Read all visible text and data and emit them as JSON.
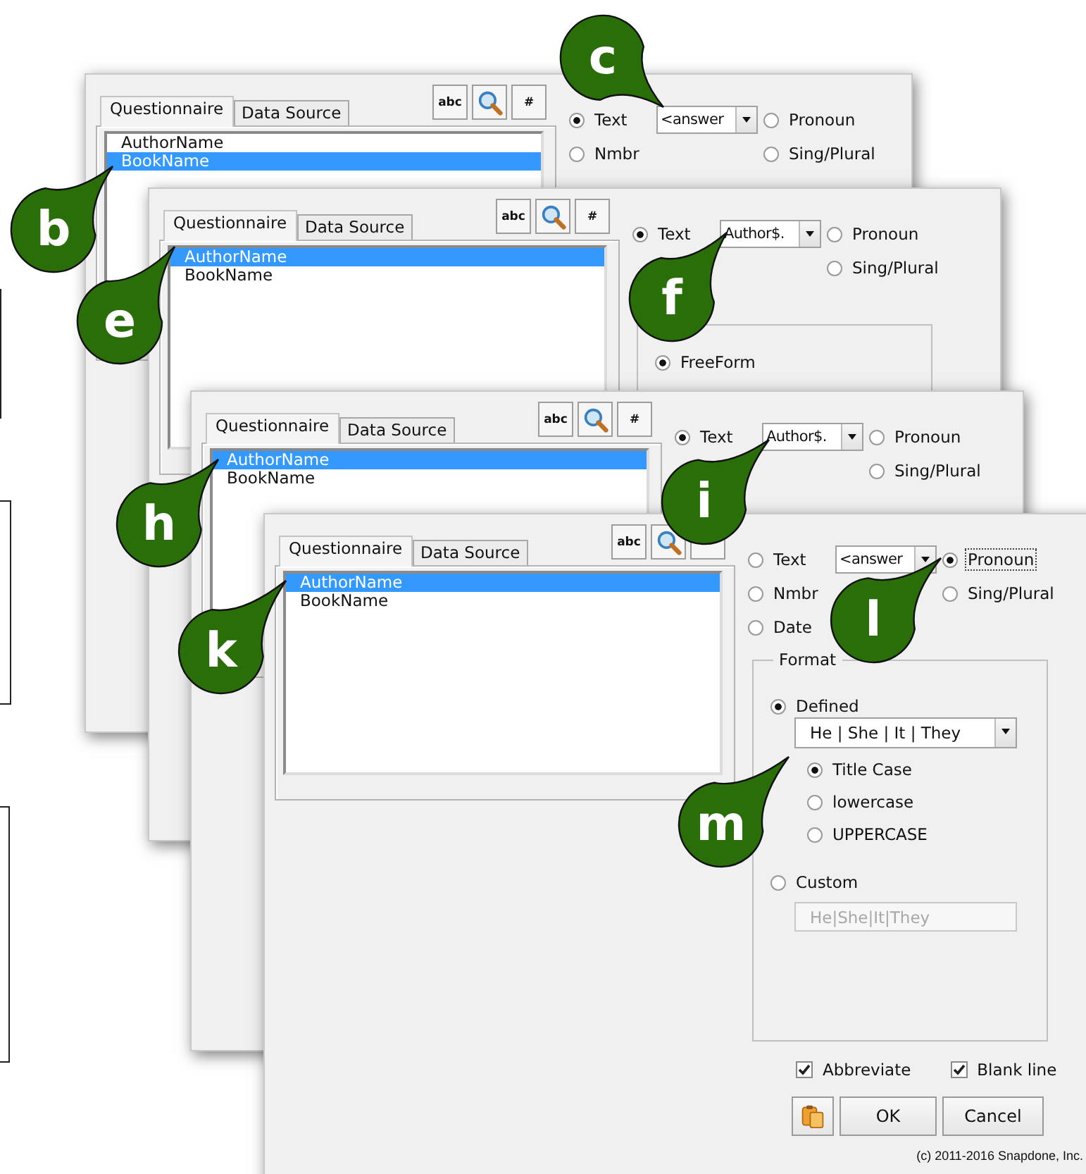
{
  "windows": [
    {
      "tabs": [
        {
          "label": "Questionnaire",
          "selected": true
        },
        {
          "label": "Data Source",
          "selected": false
        }
      ],
      "tools": [
        {
          "kind": "text",
          "label": "abc"
        },
        {
          "kind": "search"
        },
        {
          "kind": "text",
          "label": "#"
        }
      ],
      "list": [
        {
          "label": "AuthorName",
          "selected": false
        },
        {
          "label": "BookName",
          "selected": true
        }
      ],
      "type_rows": [
        {
          "left": {
            "label": "Text",
            "selected": true,
            "focused": false
          },
          "combo": "<answer",
          "right": {
            "label": "Pronoun",
            "selected": false,
            "focused": false
          }
        },
        {
          "left": {
            "label": "Nmbr",
            "selected": false,
            "focused": false
          },
          "right": {
            "label": "Sing/Plural",
            "selected": false,
            "focused": false
          }
        }
      ]
    },
    {
      "tabs": [
        {
          "label": "Questionnaire",
          "selected": true
        },
        {
          "label": "Data Source",
          "selected": false
        }
      ],
      "tools": [
        {
          "kind": "text",
          "label": "abc"
        },
        {
          "kind": "search"
        },
        {
          "kind": "text",
          "label": "#"
        }
      ],
      "list": [
        {
          "label": "AuthorName",
          "selected": true
        },
        {
          "label": "BookName",
          "selected": false
        }
      ],
      "type_rows": [
        {
          "left": {
            "label": "Text",
            "selected": true,
            "focused": false
          },
          "combo": "Author$.",
          "right": {
            "label": "Pronoun",
            "selected": false,
            "focused": false
          }
        },
        {
          "right": {
            "label": "Sing/Plural",
            "selected": false,
            "focused": false
          }
        }
      ],
      "format": {
        "options": [
          {
            "label": "FreeForm",
            "selected": true
          }
        ]
      }
    },
    {
      "tabs": [
        {
          "label": "Questionnaire",
          "selected": true
        },
        {
          "label": "Data Source",
          "selected": false
        }
      ],
      "tools": [
        {
          "kind": "text",
          "label": "abc"
        },
        {
          "kind": "search"
        },
        {
          "kind": "text",
          "label": "#"
        }
      ],
      "list": [
        {
          "label": "AuthorName",
          "selected": true
        },
        {
          "label": "BookName",
          "selected": false
        }
      ],
      "type_rows": [
        {
          "left": {
            "label": "Text",
            "selected": true,
            "focused": false
          },
          "combo": "Author$.",
          "right": {
            "label": "Pronoun",
            "selected": false,
            "focused": false
          }
        },
        {
          "right": {
            "label": "Sing/Plural",
            "selected": false,
            "focused": false
          }
        }
      ]
    },
    {
      "tabs": [
        {
          "label": "Questionnaire",
          "selected": true
        },
        {
          "label": "Data Source",
          "selected": false
        }
      ],
      "tools": [
        {
          "kind": "text",
          "label": "abc"
        },
        {
          "kind": "search"
        },
        {
          "kind": "empty"
        }
      ],
      "list": [
        {
          "label": "AuthorName",
          "selected": true
        },
        {
          "label": "BookName",
          "selected": false
        }
      ],
      "type_rows": [
        {
          "left": {
            "label": "Text",
            "selected": false,
            "focused": false
          },
          "combo": "<answer",
          "right": {
            "label": "Pronoun",
            "selected": true,
            "focused": true
          }
        },
        {
          "left": {
            "label": "Nmbr",
            "selected": false,
            "focused": false
          },
          "right": {
            "label": "Sing/Plural",
            "selected": false,
            "focused": false
          }
        },
        {
          "left": {
            "label": "Date",
            "selected": false,
            "focused": false
          }
        }
      ],
      "format": {
        "label": "Format",
        "options": [
          {
            "label": "Defined",
            "selected": true,
            "combo": "He | She | It | They",
            "sub_options": [
              {
                "label": "Title Case",
                "selected": true
              },
              {
                "label": "lowercase",
                "selected": false
              },
              {
                "label": "UPPERCASE",
                "selected": false
              }
            ]
          },
          {
            "label": "Custom",
            "selected": false,
            "field": {
              "value": "He|She|It|They",
              "disabled": true
            }
          }
        ]
      },
      "checkboxes": [
        {
          "label": "Abbreviate",
          "checked": true
        },
        {
          "label": "Blank line",
          "checked": true
        }
      ],
      "buttons": [
        {
          "kind": "paste"
        },
        {
          "kind": "text",
          "label": "OK"
        },
        {
          "kind": "text",
          "label": "Cancel"
        }
      ],
      "copyright": "(c) 2011-2016 Snapdone, Inc."
    }
  ],
  "callouts": [
    {
      "letter": "b"
    },
    {
      "letter": "c"
    },
    {
      "letter": "e"
    },
    {
      "letter": "f"
    },
    {
      "letter": "h"
    },
    {
      "letter": "i"
    },
    {
      "letter": "k"
    },
    {
      "letter": "l"
    },
    {
      "letter": "m"
    }
  ]
}
